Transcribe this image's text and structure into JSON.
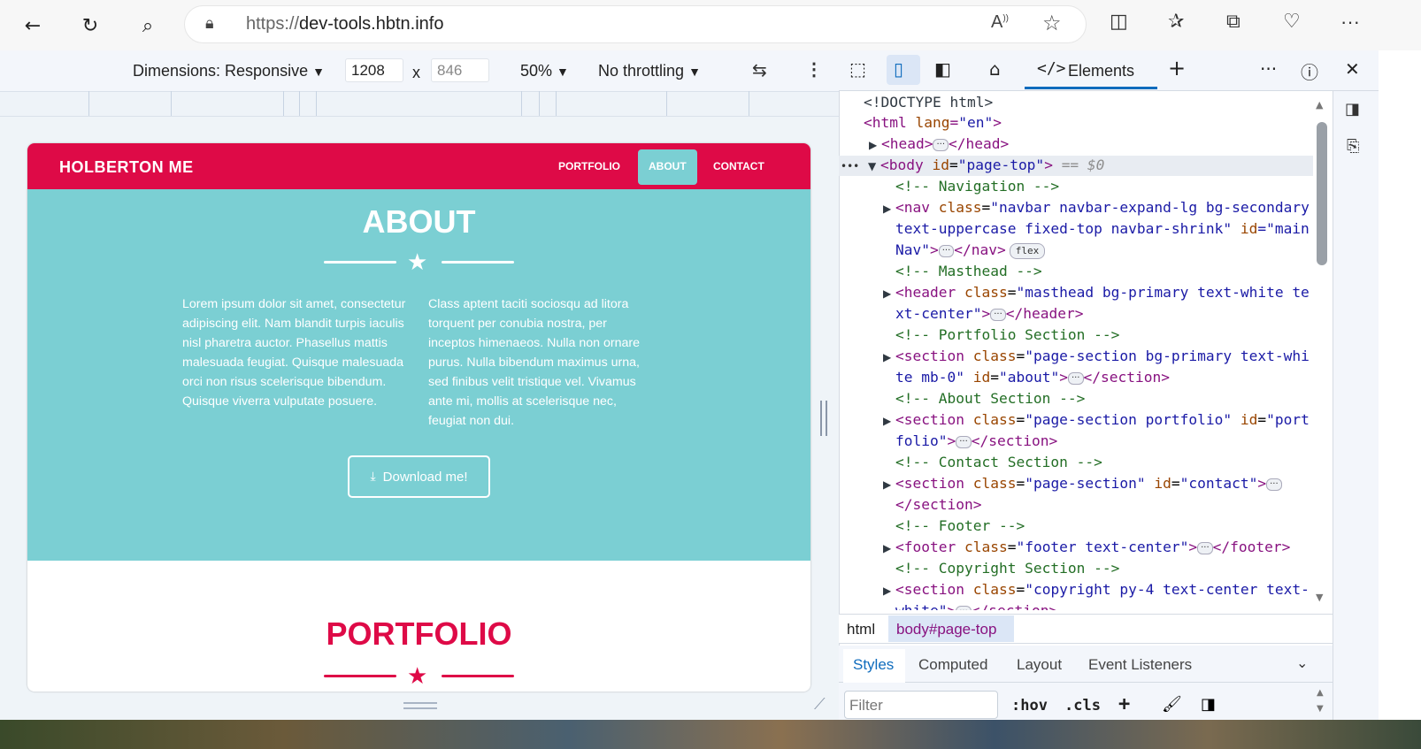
{
  "browser": {
    "url_scheme": "https://",
    "url_host": "dev-tools.hbtn.info",
    "back_icon": "back-arrow-icon",
    "refresh_icon": "refresh-icon",
    "search_icon": "search-icon"
  },
  "device_toolbar": {
    "dimensions_label": "Dimensions: Responsive",
    "width": "1208",
    "height": "846",
    "times": "x",
    "zoom": "50%",
    "throttling": "No throttling"
  },
  "site": {
    "brand": "HOLBERTON ME",
    "nav": [
      "PORTFOLIO",
      "ABOUT",
      "CONTACT"
    ],
    "active_nav": "ABOUT",
    "about_title": "ABOUT",
    "about_col1": "Lorem ipsum dolor sit amet, consectetur adipiscing elit. Nam blandit turpis iaculis nisl pharetra auctor. Phasellus mattis malesuada feugiat. Quisque malesuada orci non risus scelerisque bibendum. Quisque viverra vulputate posuere.",
    "about_col2": "Class aptent taciti sociosqu ad litora torquent per conubia nostra, per inceptos himenaeos. Nulla non ornare purus. Nulla bibendum maximus urna, sed finibus velit tristique vel. Vivamus ante mi, mollis at scelerisque nec, feugiat non dui.",
    "download_label": "Download me!",
    "portfolio_title": "PORTFOLIO",
    "colors": {
      "primary": "#de0a47",
      "secondary": "#7bcfd3"
    }
  },
  "devtools": {
    "tab_elements": "Elements",
    "breadcrumb": [
      "html",
      "body#page-top"
    ],
    "styles_tabs": [
      "Styles",
      "Computed",
      "Layout",
      "Event Listeners"
    ],
    "filter_placeholder": "Filter",
    "hov": ":hov",
    "cls": ".cls",
    "dom": {
      "doctype": "<!DOCTYPE html>",
      "html_open": "<html lang=\"en\">",
      "head": "<head>",
      "head_close": "</head>",
      "body_tag": "<body",
      "body_attr": "id",
      "body_val": "\"page-top\"",
      "body_suffix": "== $0",
      "comments": [
        "<!-- Navigation -->",
        "<!-- Masthead -->",
        "<!-- Portfolio Section -->",
        "<!-- About Section -->",
        "<!-- Contact Section -->",
        "<!-- Footer -->",
        "<!-- Copyright Section -->"
      ],
      "flex_badge": "flex"
    }
  }
}
